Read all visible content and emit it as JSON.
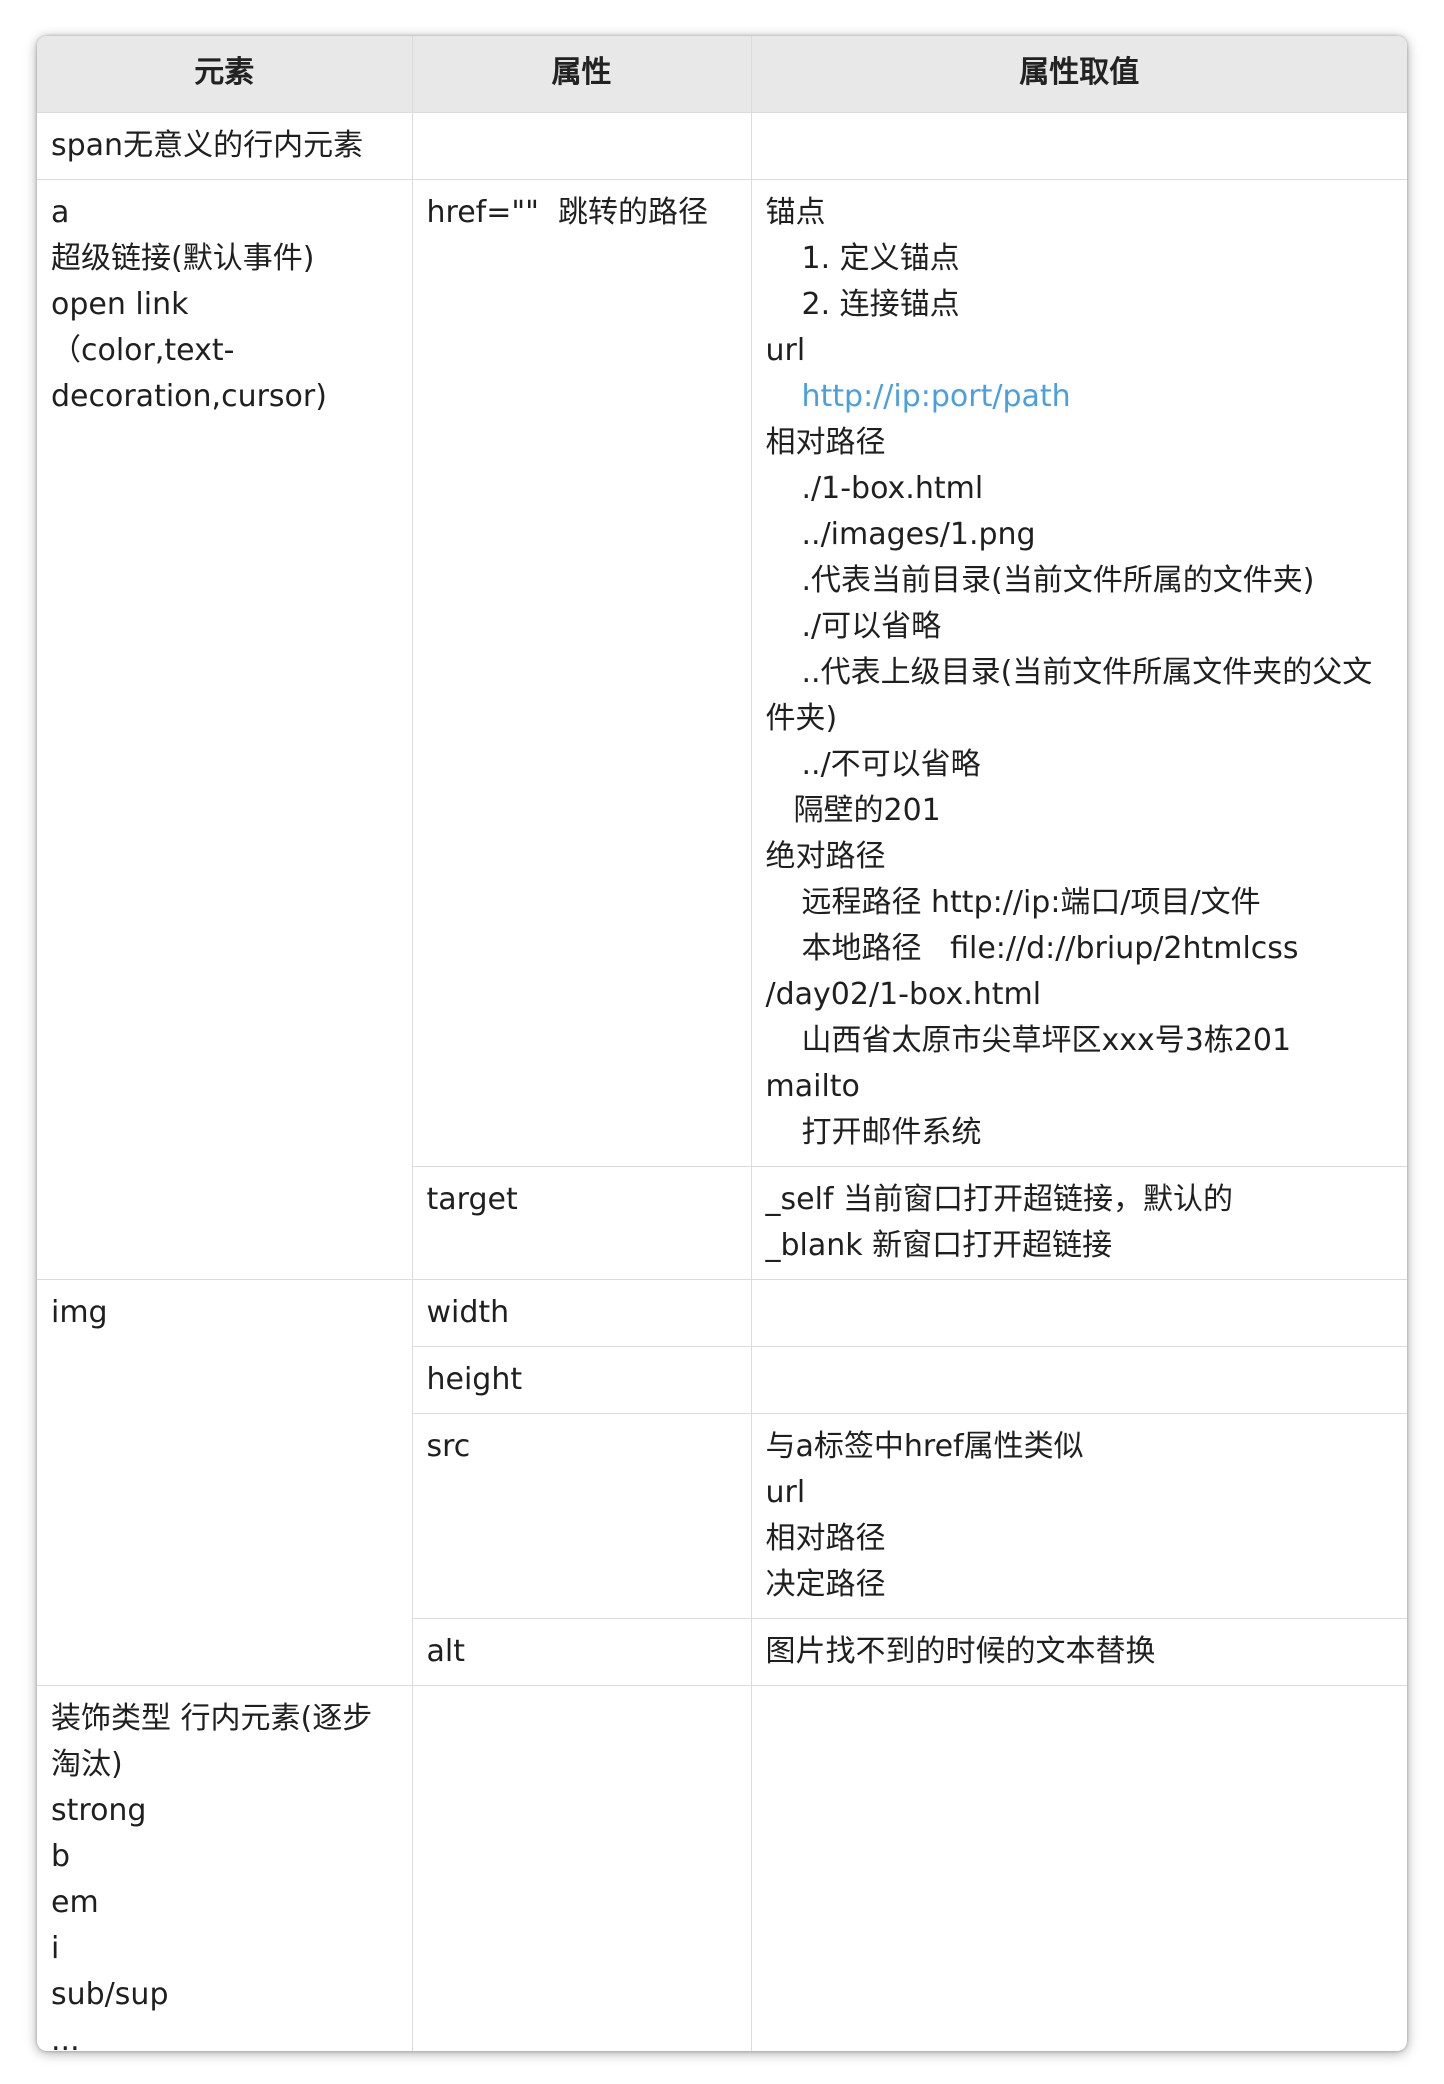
{
  "table": {
    "headers": [
      "元素",
      "属性",
      "属性取值"
    ],
    "span": {
      "element": "span无意义的行内元素"
    },
    "a": {
      "element_lines": [
        "a",
        "超级链接(默认事件)",
        "open link",
        "（color,text-",
        "decoration,cursor)"
      ],
      "href": {
        "attr": "href=\"\"  跳转的路径",
        "anchor": "锚点",
        "anchor_1": "1. 定义锚点",
        "anchor_2": "2. 连接锚点",
        "url": "url",
        "url_example": "http://ip:port/path",
        "relative": "相对路径",
        "rel_1": "./1-box.html",
        "rel_2": "../images/1.png",
        "rel_3": ".代表当前目录(当前文件所属的文件夹)",
        "rel_4": "./可以省略",
        "rel_5": "..代表上级目录(当前文件所属文件夹的父文件夹)",
        "rel_6": "../不可以省略",
        "rel_7": "隔壁的201",
        "absolute": "绝对路径",
        "abs_1": "远程路径 http://ip:端口/项目/文件",
        "abs_2": "本地路径   file://d://briup/2htmlcss /day02/1-box.html",
        "abs_3": "山西省太原市尖草坪区xxx号3栋201",
        "mailto": "mailto",
        "mailto_1": "打开邮件系统"
      },
      "target": {
        "attr": "target",
        "val_1": "_self 当前窗口打开超链接，默认的",
        "val_2": "_blank 新窗口打开超链接"
      }
    },
    "img": {
      "element": "img",
      "width": "width",
      "height": "height",
      "src": {
        "attr": "src",
        "val_1": "与a标签中href属性类似",
        "val_2": "url",
        "val_3": "相对路径",
        "val_4": "决定路径"
      },
      "alt": {
        "attr": "alt",
        "val": "图片找不到的时候的文本替换"
      }
    },
    "decor": {
      "element_lines": [
        "装饰类型 行内元素(逐步淘汰)",
        "strong",
        "b",
        "em",
        "i",
        "sub/sup",
        "..."
      ]
    }
  }
}
